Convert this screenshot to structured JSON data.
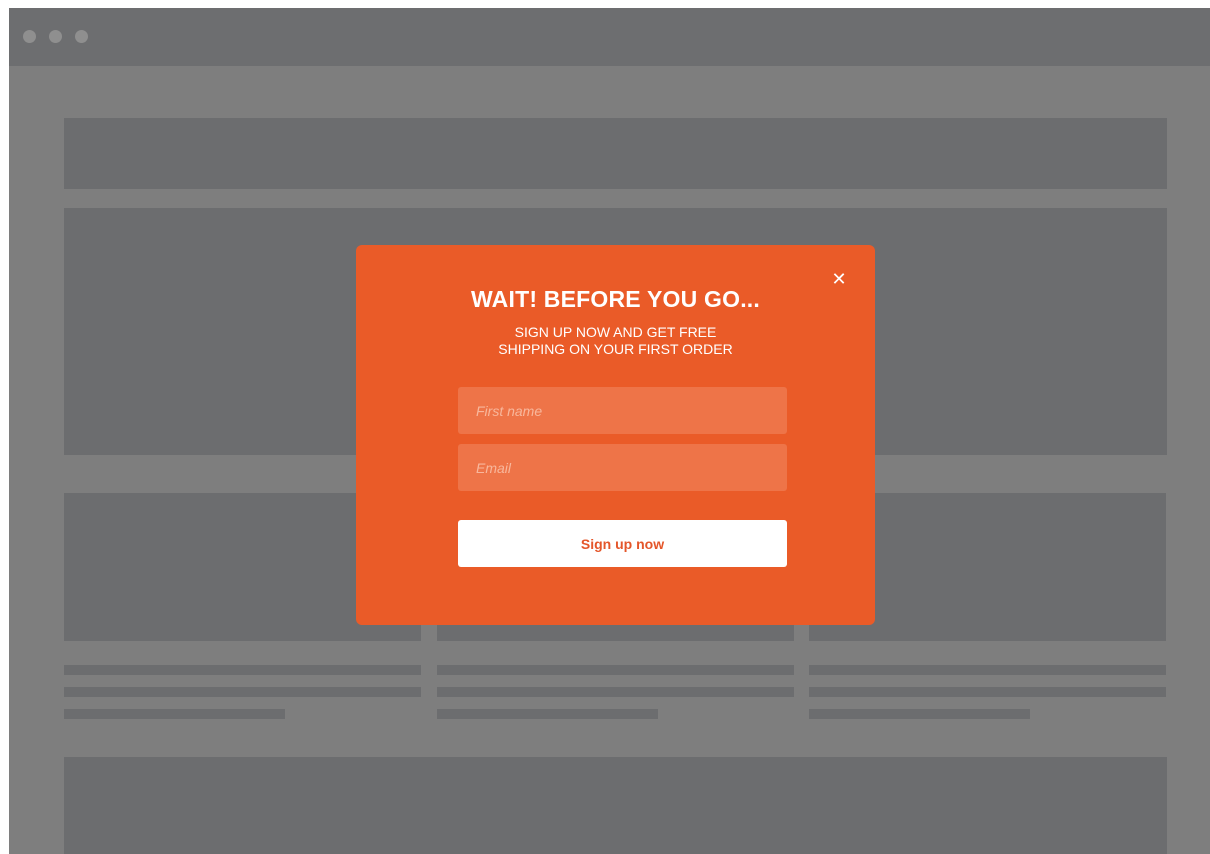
{
  "popup": {
    "close_icon": "close-icon",
    "close_glyph": "✕",
    "title": "WAIT! BEFORE YOU GO...",
    "subtitle_line1": "SIGN UP NOW AND GET FREE",
    "subtitle_line2": "SHIPPING ON YOUR FIRST ORDER",
    "first_name_placeholder": "First name",
    "email_placeholder": "Email",
    "submit_label": "Sign up now",
    "accent_color": "#ea5b28"
  }
}
